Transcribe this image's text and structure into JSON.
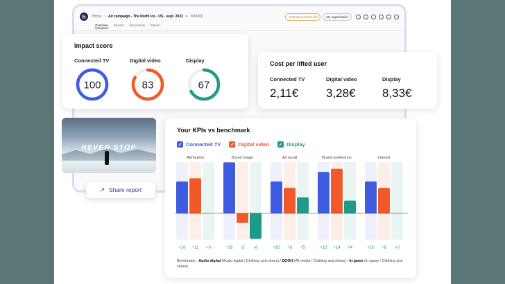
{
  "app": {
    "breadcrumb": {
      "home": "Home",
      "campaign": "Ad campaign - The North Ice - US - sept. 2023",
      "status": "300/300"
    },
    "warning_pill": "2 Measurements left",
    "org_pill": "My organization",
    "tabs": [
      {
        "label": "Overview",
        "active": true
      },
      {
        "label": "Results",
        "active": false
      },
      {
        "label": "Benchmark",
        "active": false
      },
      {
        "label": "Report",
        "active": false
      }
    ]
  },
  "impact": {
    "title": "Impact score",
    "items": [
      {
        "label": "Connected TV",
        "value": 100,
        "score_fraction": 1.0,
        "color": "#3f5be0"
      },
      {
        "label": "Digital video",
        "value": 83,
        "score_fraction": 0.83,
        "color": "#f0592a"
      },
      {
        "label": "Display",
        "value": 67,
        "score_fraction": 0.67,
        "color": "#1f9a8a"
      }
    ]
  },
  "cost": {
    "title": "Cost per lifted user",
    "items": [
      {
        "label": "Connected TV",
        "value": "2,11€"
      },
      {
        "label": "Digital video",
        "value": "3,28€"
      },
      {
        "label": "Display",
        "value": "8,33€"
      }
    ]
  },
  "photo": {
    "text": "NEVER STOP"
  },
  "share": {
    "label": "Share report"
  },
  "kpi": {
    "title": "Your KPIs vs benchmark",
    "legend": [
      {
        "label": "Connected TV",
        "color": "#3f5be0",
        "text_color": "#3f5be0"
      },
      {
        "label": "Digital video",
        "color": "#f0592a",
        "text_color": "#f0592a"
      },
      {
        "label": "Display",
        "color": "#1f9a8a",
        "text_color": "#1f9a8a"
      }
    ],
    "benchmark_prefix": "Benchmark :",
    "benchmark_parts": [
      {
        "bold": "Audio digital",
        "rest": " (Audio digital / Clothing and shoes) / "
      },
      {
        "bold": "DOOH",
        "rest": " (All media / Clothing and shoes) / "
      },
      {
        "bold": "In-game",
        "rest": " (In-game / Clothing and shoes)"
      }
    ]
  },
  "chart_data": {
    "type": "bar",
    "categories": [
      "Attribution",
      "Brand image",
      "Ad recall",
      "Brand preference",
      "Interest"
    ],
    "series": [
      {
        "name": "Connected TV",
        "color": "#3f5be0",
        "values": [
          10,
          16,
          10,
          13,
          10
        ]
      },
      {
        "name": "Digital video",
        "color": "#f0592a",
        "values": [
          11,
          -3,
          8,
          14,
          8
        ]
      },
      {
        "name": "Display",
        "color": "#1f9a8a",
        "values": [
          0,
          -8,
          5,
          4,
          0
        ]
      }
    ],
    "value_labels": [
      [
        "+10",
        "+11",
        "+0"
      ],
      [
        "+16",
        "-3",
        "-8"
      ],
      [
        "+10",
        "+8",
        "+5"
      ],
      [
        "+13",
        "+14",
        "+4"
      ],
      [
        "+10",
        "+8",
        "+0"
      ]
    ],
    "ylim": [
      -10,
      17
    ],
    "grid": false,
    "legend_position": "top-left"
  }
}
